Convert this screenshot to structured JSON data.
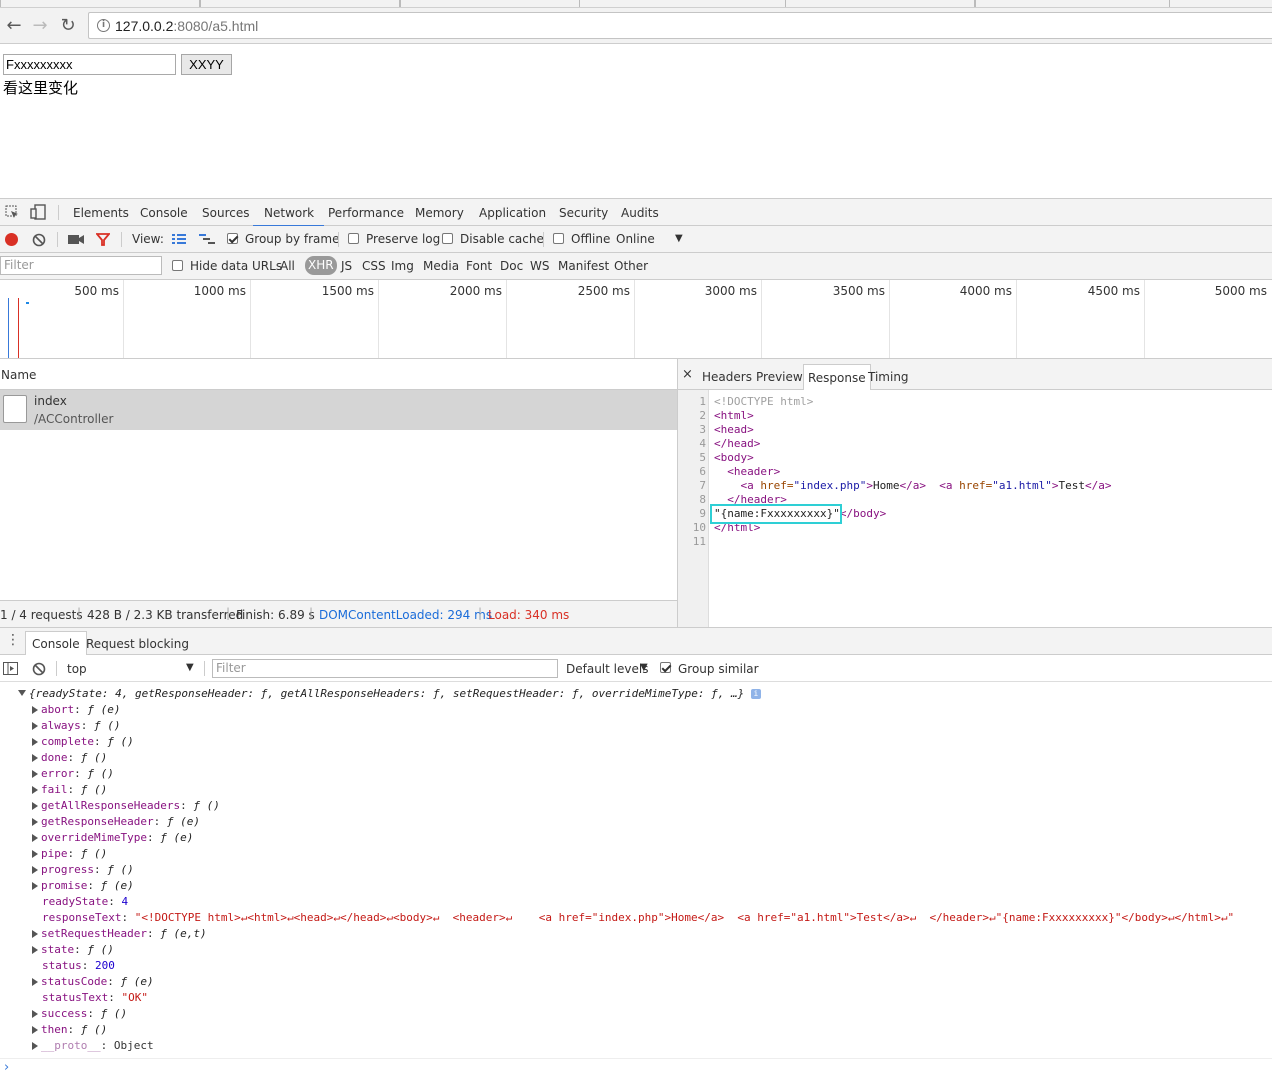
{
  "browser": {
    "url_host": "127.0.0.2",
    "url_path": ":8080/a5.html"
  },
  "page": {
    "input_value": "Fxxxxxxxxx",
    "button_label": "XXYY",
    "message": "看这里变化"
  },
  "devtools": {
    "tabs": [
      "Elements",
      "Console",
      "Sources",
      "Network",
      "Performance",
      "Memory",
      "Application",
      "Security",
      "Audits"
    ],
    "active_tab": "Network",
    "network_toolbar": {
      "view_label": "View:",
      "group_by_frame": "Group by frame",
      "preserve_log": "Preserve log",
      "disable_cache": "Disable cache",
      "offline": "Offline",
      "throttle": "Online"
    },
    "filter_bar": {
      "placeholder": "Filter",
      "hide_data_urls": "Hide data URLs",
      "types": [
        "All",
        "XHR",
        "JS",
        "CSS",
        "Img",
        "Media",
        "Font",
        "Doc",
        "WS",
        "Manifest",
        "Other"
      ],
      "active_type": "XHR"
    },
    "timeline_ticks": [
      "500 ms",
      "1000 ms",
      "1500 ms",
      "2000 ms",
      "2500 ms",
      "3000 ms",
      "3500 ms",
      "4000 ms",
      "4500 ms",
      "5000 ms"
    ],
    "requests": {
      "column_name": "Name",
      "items": [
        {
          "name": "index",
          "path": "/ACController"
        }
      ]
    },
    "summary": {
      "requests": "1 / 4 requests",
      "transferred": "428 B / 2.3 KB transferred",
      "finish": "Finish: 6.89 s",
      "dom_loaded": "DOMContentLoaded: 294 ms",
      "load": "Load: 340 ms"
    },
    "detail_tabs": [
      "Headers",
      "Preview",
      "Response",
      "Timing"
    ],
    "active_detail_tab": "Response",
    "response_lines": [
      "1",
      "2",
      "3",
      "4",
      "5",
      "6",
      "7",
      "8",
      "9",
      "10",
      "11"
    ],
    "response": {
      "l1": "<!DOCTYPE html>",
      "l2": "<html>",
      "l3": "<head>",
      "l4": "</head>",
      "l5": "<body>",
      "l6": "  <header>",
      "l7_indent": "    ",
      "l7_a1_open": "<a ",
      "l7_a1_attr": "href=",
      "l7_a1_val": "\"index.php\"",
      "l7_a1_close": ">",
      "l7_home": "Home",
      "l7_a1_end": "</a>",
      "l7_gap": "  ",
      "l7_a2_open": "<a ",
      "l7_a2_attr": "href=",
      "l7_a2_val": "\"a1.html\"",
      "l7_a2_close": ">",
      "l7_test": "Test",
      "l7_a2_end": "</a>",
      "l8": "  </header>",
      "l9_text": "\"{name:Fxxxxxxxxx}\"",
      "l9_tag": "</body>",
      "l10": "</html>"
    },
    "drawer": {
      "tabs": [
        "Console",
        "Request blocking"
      ],
      "context": "top",
      "filter_placeholder": "Filter",
      "levels": "Default levels",
      "group_similar": "Group similar"
    },
    "console": {
      "summary": "{readyState: 4, getResponseHeader: ƒ, getAllResponseHeaders: ƒ, setRequestHeader: ƒ, overrideMimeType: ƒ, …}",
      "props": [
        {
          "key": "abort",
          "val": "ƒ (e)",
          "expand": true,
          "type": "f"
        },
        {
          "key": "always",
          "val": "ƒ ()",
          "expand": true,
          "type": "f"
        },
        {
          "key": "complete",
          "val": "ƒ ()",
          "expand": true,
          "type": "f"
        },
        {
          "key": "done",
          "val": "ƒ ()",
          "expand": true,
          "type": "f"
        },
        {
          "key": "error",
          "val": "ƒ ()",
          "expand": true,
          "type": "f"
        },
        {
          "key": "fail",
          "val": "ƒ ()",
          "expand": true,
          "type": "f"
        },
        {
          "key": "getAllResponseHeaders",
          "val": "ƒ ()",
          "expand": true,
          "type": "f"
        },
        {
          "key": "getResponseHeader",
          "val": "ƒ (e)",
          "expand": true,
          "type": "f"
        },
        {
          "key": "overrideMimeType",
          "val": "ƒ (e)",
          "expand": true,
          "type": "f"
        },
        {
          "key": "pipe",
          "val": "ƒ ()",
          "expand": true,
          "type": "f"
        },
        {
          "key": "progress",
          "val": "ƒ ()",
          "expand": true,
          "type": "f"
        },
        {
          "key": "promise",
          "val": "ƒ (e)",
          "expand": true,
          "type": "f"
        },
        {
          "key": "readyState",
          "val": "4",
          "expand": false,
          "type": "n"
        },
        {
          "key": "responseText",
          "val": "\"<!DOCTYPE html>↵<html>↵<head>↵</head>↵<body>↵  <header>↵    <a href=\"index.php\">Home</a>  <a href=\"a1.html\">Test</a>↵  </header>↵\"{name:Fxxxxxxxxx}\"</body>↵</html>↵\"",
          "expand": false,
          "type": "s"
        },
        {
          "key": "setRequestHeader",
          "val": "ƒ (e,t)",
          "expand": true,
          "type": "f"
        },
        {
          "key": "state",
          "val": "ƒ ()",
          "expand": true,
          "type": "f"
        },
        {
          "key": "status",
          "val": "200",
          "expand": false,
          "type": "n"
        },
        {
          "key": "statusCode",
          "val": "ƒ (e)",
          "expand": true,
          "type": "f"
        },
        {
          "key": "statusText",
          "val": "\"OK\"",
          "expand": false,
          "type": "s"
        },
        {
          "key": "success",
          "val": "ƒ ()",
          "expand": true,
          "type": "f"
        },
        {
          "key": "then",
          "val": "ƒ ()",
          "expand": true,
          "type": "f"
        },
        {
          "key": "__proto__",
          "val": "Object",
          "expand": true,
          "type": "o"
        }
      ]
    },
    "colors": {
      "accent": "#3879d9",
      "dom_loaded": "#1a6cd9",
      "load": "#d93025",
      "highlight_box": "#2ecfd5"
    }
  }
}
